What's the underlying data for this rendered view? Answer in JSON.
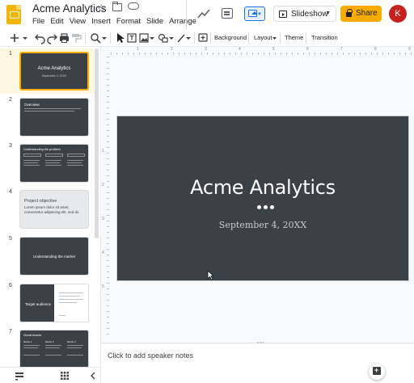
{
  "header": {
    "doc_title": "Acme Analytics",
    "menu": [
      "File",
      "Edit",
      "View",
      "Insert",
      "Format",
      "Slide",
      "Arrange"
    ],
    "slideshow_label": "Slideshow",
    "share_label": "Share",
    "avatar_initial": "K",
    "colors": {
      "share": "#f9ab00",
      "avatar": "#c5221f",
      "accent": "#1a73e8"
    }
  },
  "toolbar": {
    "background_label": "Background",
    "layout_label": "Layout",
    "theme_label": "Theme",
    "transition_label": "Transition"
  },
  "filmstrip": {
    "slides": [
      {
        "number": "1",
        "title": "Acme Analytics",
        "subtitle": "September 4, 20XX"
      },
      {
        "number": "2",
        "title": "Overview"
      },
      {
        "number": "3",
        "title": "Understanding the problem"
      },
      {
        "number": "4",
        "title": "Project objective",
        "body": "Lorem ipsum dolor sit amet, consectetur adipiscing elit, sed do"
      },
      {
        "number": "5",
        "title": "Understanding the market"
      },
      {
        "number": "6",
        "title": "Target audience"
      },
      {
        "number": "7",
        "title": "Great teams",
        "captions": [
          "Name 1",
          "Name 2",
          "Name 3"
        ]
      }
    ]
  },
  "ruler": {
    "h_labels": [
      "1",
      "2",
      "3",
      "4",
      "5",
      "6",
      "7",
      "8",
      "9"
    ],
    "v_labels": [
      "1",
      "2",
      "3",
      "4",
      "5"
    ]
  },
  "slide": {
    "title": "Acme Analytics",
    "date": "September 4, 20XX",
    "background": "#3b4247"
  },
  "notes": {
    "placeholder": "Click to add speaker notes"
  }
}
